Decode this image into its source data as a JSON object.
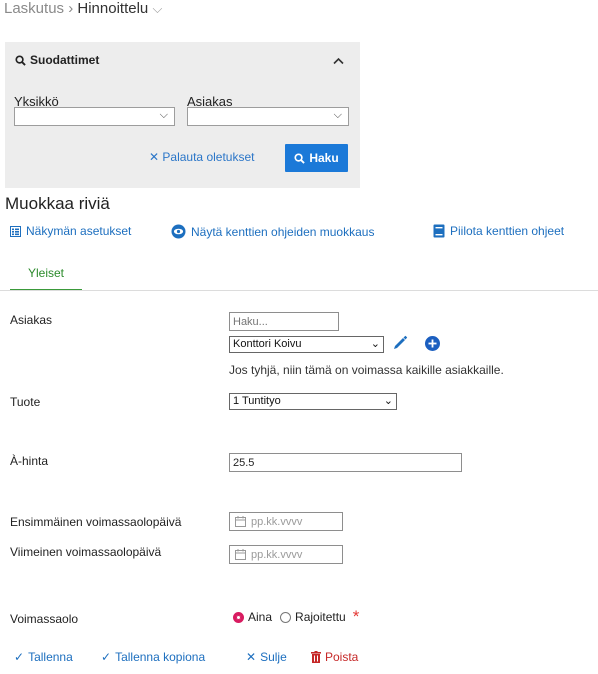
{
  "breadcrumb": {
    "parent": "Laskutus",
    "separator": "›",
    "current": "Hinnoittelu",
    "current_menu_icon": "chevron-down-icon"
  },
  "filters": {
    "title": "Suodattimet",
    "toggle_icon": "chevron-up-icon",
    "unit_label": "Yksikkö",
    "unit_value": "",
    "customer_label": "Asiakas",
    "customer_value": "",
    "reset_label": "Palauta oletukset",
    "search_label": "Haku"
  },
  "editor": {
    "title": "Muokkaa riviä",
    "toolbar": {
      "view_settings": "Näkymän asetukset",
      "show_help_editing": "Näytä kenttien ohjeiden muokkaus",
      "hide_help": "Piilota kenttien ohjeet"
    },
    "tabs": [
      {
        "label": "Yleiset",
        "active": true
      }
    ]
  },
  "form": {
    "customer": {
      "label": "Asiakas",
      "search_placeholder": "Haku...",
      "selected": "Konttori Koivu",
      "hint": "Jos tyhjä, niin tämä on voimassa kaikille asiakkaille."
    },
    "product": {
      "label": "Tuote",
      "selected": "1 Tuntityo"
    },
    "unit_price": {
      "label": "À-hinta",
      "value": "25.5"
    },
    "valid_from": {
      "label": "Ensimmäinen voimassaolopäivä",
      "placeholder": "pp.kk.vvvv"
    },
    "valid_to": {
      "label": "Viimeinen voimassaolopäivä",
      "placeholder": "pp.kk.vvvv"
    },
    "validity": {
      "label": "Voimassaolo",
      "options": [
        {
          "label": "Aina",
          "selected": true
        },
        {
          "label": "Rajoitettu",
          "selected": false
        }
      ],
      "required_mark": "*"
    }
  },
  "actions": {
    "save": "Tallenna",
    "save_copy": "Tallenna kopiona",
    "close": "Sulje",
    "delete": "Poista"
  },
  "colors": {
    "link_blue": "#1d6fbf",
    "button_blue": "#1b79d8",
    "tab_green": "#2a8a2a",
    "delete_red": "#c62828",
    "radio_pink": "#d81b60"
  }
}
